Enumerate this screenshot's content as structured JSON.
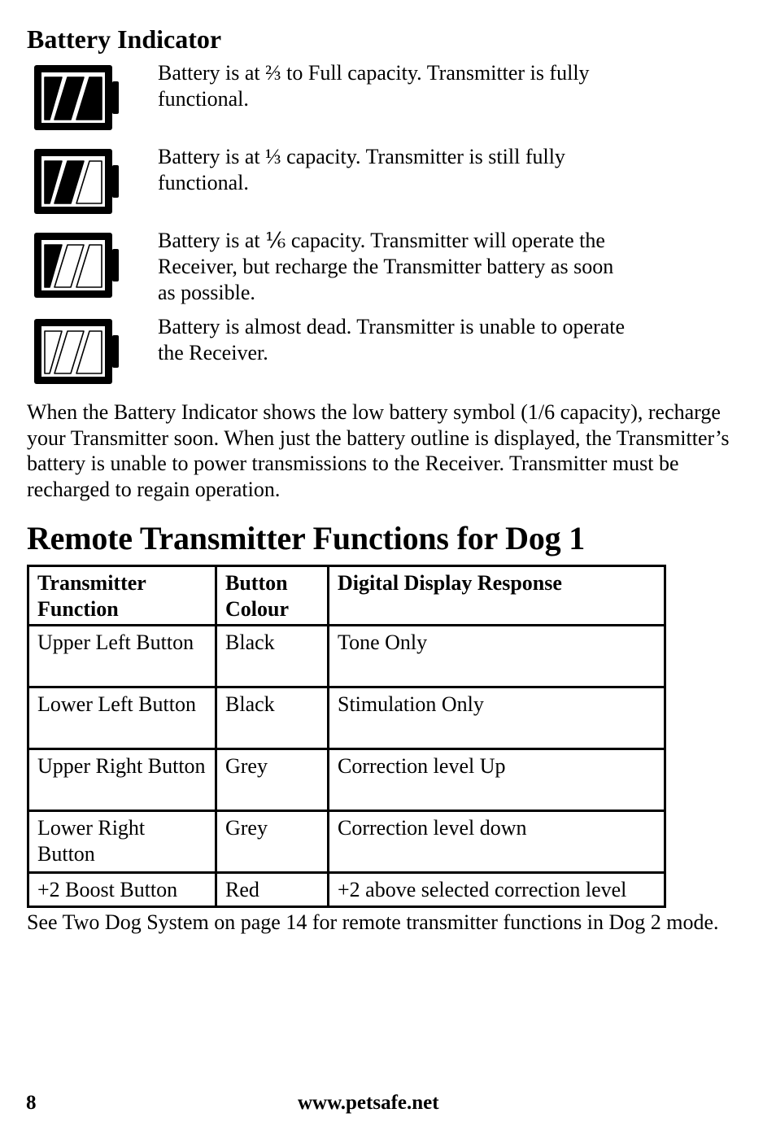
{
  "battery_section": {
    "heading": "Battery Indicator",
    "levels": [
      {
        "icon": "battery-full-icon",
        "filled_bars": 3,
        "text": "Battery is at ⅔ to Full capacity. Transmitter is fully functional."
      },
      {
        "icon": "battery-one-third-icon",
        "filled_bars": 2,
        "text": "Battery is at ⅓ capacity. Transmitter is still fully functional."
      },
      {
        "icon": "battery-one-sixth-icon",
        "filled_bars": 1,
        "text": "Battery is at ⅙ capacity. Transmitter will operate the Receiver, but recharge the Transmitter battery as soon as possible."
      },
      {
        "icon": "battery-empty-icon",
        "filled_bars": 0,
        "text": "Battery is almost dead. Transmitter is unable to operate the Receiver."
      }
    ],
    "explanation": "When the Battery Indicator shows the low battery symbol (1/6 capacity), recharge your Transmitter soon. When just the battery outline is displayed, the Transmitter’s battery is unable to power transmissions to the Receiver. Transmitter must be recharged to regain operation."
  },
  "functions_section": {
    "heading": "Remote Transmitter Functions for Dog 1",
    "table": {
      "headers": [
        "Transmitter Function",
        "Button Colour",
        "Digital Display Response"
      ],
      "rows": [
        [
          "Upper Left Button",
          "Black",
          "Tone Only"
        ],
        [
          "Lower Left Button",
          "Black",
          "Stimulation Only"
        ],
        [
          "Upper Right Button",
          "Grey",
          "Correction level Up"
        ],
        [
          "Lower Right Button",
          "Grey",
          "Correction level down"
        ],
        [
          "+2 Boost Button",
          "Red",
          "+2 above selected correction level"
        ]
      ]
    },
    "note": "See Two Dog System on page 14 for remote transmitter functions in Dog 2 mode."
  },
  "footer": {
    "page_number": "8",
    "website": "www.petsafe.net"
  }
}
